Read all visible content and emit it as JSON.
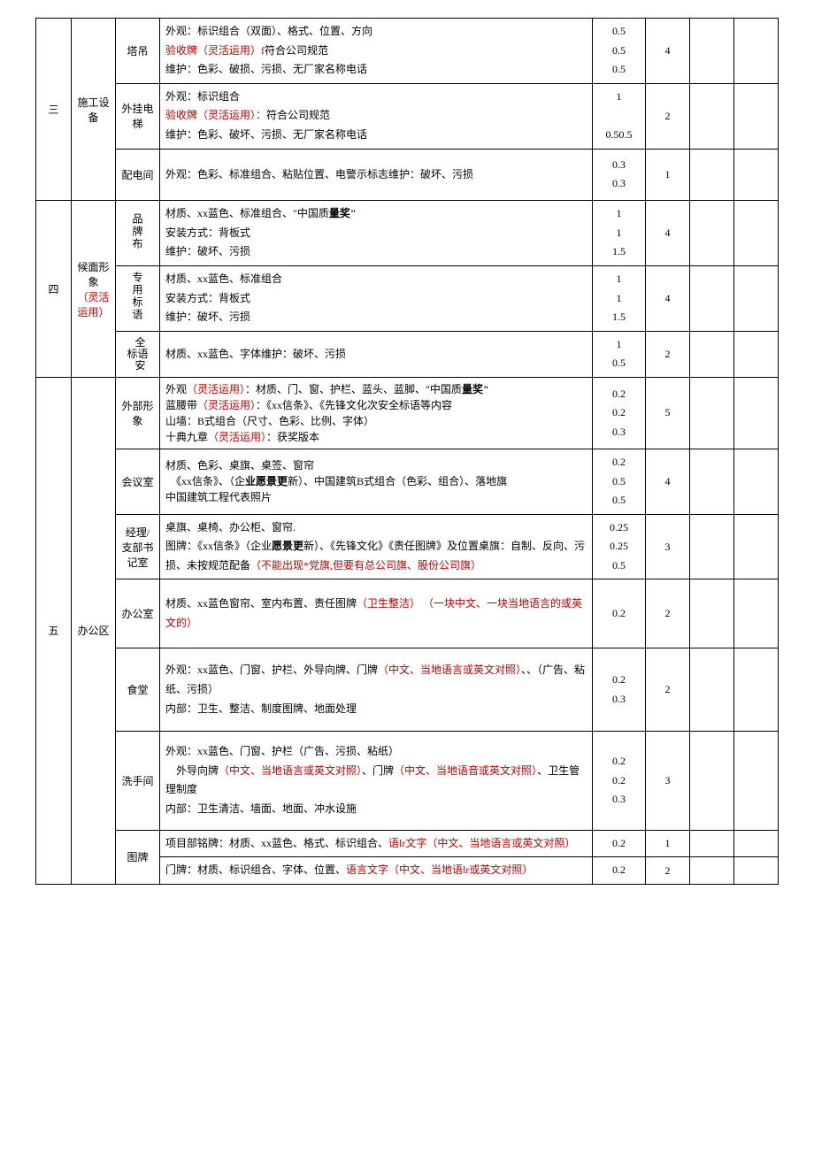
{
  "rows": {
    "r3": {
      "idx": "三",
      "cat": "施工设备",
      "sub1": "塔吊",
      "c1a": "外观：标识组合（双面）、格式、位置、方向",
      "c1b_red": "验收牌（灵活运用）f",
      "c1b_black": "符合公司规范",
      "c1c": "维护：色彩、破损、污损、无厂家名称电话",
      "s1a": "0.5",
      "s1b": "0.5",
      "s1c": "0.5",
      "t1": "4",
      "sub2": "外挂电梯",
      "c2a": "外观：标识组合",
      "c2b_red": "验收牌（灵活运用）：",
      "c2b_black": "符合公司规范",
      "c2c": "维护：色彩、破坏、污损、无厂家名称电话",
      "s2a": "1",
      "s2b": "0.50.5",
      "t2": "2",
      "sub3": "配电间",
      "c3": "外观：色彩、标准组合、粘贴位置、电警示标志维护：破坏、污损",
      "s3a": "0.3",
      "s3b": "0.3",
      "t3": "1"
    },
    "r4": {
      "idx": "四",
      "cat_l1": "候面形象",
      "cat_l2_red": "（灵活运用）",
      "sub1": "品牌布",
      "c1a_a": "材质、",
      "c1a_b": "xx",
      "c1a_c": "蓝色、标准组合、\"中国质",
      "c1a_d": "量奖\"",
      "c1b": "安装方式：背板式",
      "c1c": "维护：破坏、污损",
      "s1a": "1",
      "s1b": "1",
      "s1c": "1.5",
      "t1": "4",
      "sub2": "专用标语",
      "c2a_a": "材质、",
      "c2a_b": "xx",
      "c2a_c": "蓝色、标准组合",
      "c2b": "安装方式：背板式",
      "c2c": "维护：破坏、污损",
      "s2a": "1",
      "s2b": "1",
      "s2c": "1.5",
      "t2": "4",
      "sub3": "全标语安",
      "c3_a": "材质、",
      "c3_b": "xx",
      "c3_c": "蓝色、字体维护：破坏、污损",
      "s3a": "1",
      "s3b": "0.5",
      "t3": "2"
    },
    "r5": {
      "idx": "五",
      "cat": "办公区",
      "sub1": "外部形象",
      "c1_l1a": "外观",
      "c1_l1b_red": "（灵活运用）",
      "c1_l1c": "：材质、门、窗、护栏、蓝头、蓝脚、\"中国质",
      "c1_l1d": "量奖\"",
      "c1_l2a": "蓝腰带",
      "c1_l2b_red": "（灵活运用）",
      "c1_l2c": "：《",
      "c1_l2d": "xx",
      "c1_l2e": "信条》、《先锋文化次安全标语等内容",
      "c1_l3a": "山墙：",
      "c1_l3b": "B",
      "c1_l3c": "式组合（尺寸、色彩、比例、字体）",
      "c1_l4a": "十典九章",
      "c1_l4b_red": "（灵活运用）",
      "c1_l4c": "：获奖版本",
      "s1a": "0.2",
      "s1b": "0.2",
      "s1c": "0.3",
      "t1": "5",
      "sub2": "会议室",
      "c2_l1": "材质、色彩、桌旗、桌签、窗帘",
      "c2_l2a": "《",
      "c2_l2b": "xx",
      "c2_l2c": "信条》、（企",
      "c2_l2d": "业愿景更",
      "c2_l2e": "新）、中国建筑",
      "c2_l2f": "B",
      "c2_l2g": "式组合（色彩、组合）、落地旗",
      "c2_l3": "中国建筑工程代表照片",
      "s2a": "0.2",
      "s2b": "0.5",
      "s2c": "0.5",
      "t2": "4",
      "sub3": "经理/支部书记室",
      "c3_l1": "桌旗、桌椅、办公柜、窗帘.",
      "c3_l2a": "图牌：《",
      "c3_l2b": "xx",
      "c3_l2c": "信条》（企业",
      "c3_l2d": "愿景更",
      "c3_l2e": "新）、《先锋文化》《责任图牌》及位置桌旗：自制、反向、污损、未按规范配备",
      "c3_l2f_red": "（不能出现*党旗,但要有总公司旗、股份公司旗）",
      "s3a": "0.25",
      "s3b": "0.25",
      "s3c": "0.5",
      "t3": "3",
      "sub4": "办公室",
      "c4_a": "材质、",
      "c4_b": "xx",
      "c4_c": "蓝色窗帘、室内布置、责任图牌",
      "c4_d_red": "（卫生整洁）",
      "c4_e": "  ",
      "c4_f_red": "（一块中文、一块当地语言的或英文的）",
      "s4": "0.2",
      "t4": "2",
      "sub5": "食堂",
      "c5_l1a": "外观：",
      "c5_l1b": "xx",
      "c5_l1c": "蓝色、门窗、护栏、外导向牌、门牌",
      "c5_l1d_red": "（中文、当地语言或英文对照）",
      "c5_l1e": "、、（广告、粘纸、污损）",
      "c5_l2": "内部：卫生、整洁、制度图牌、地面处理",
      "s5a": "0.2",
      "s5b": "0.3",
      "t5": "2",
      "sub6": "洗手间",
      "c6_l1a": "外观：",
      "c6_l1b": "xx",
      "c6_l1c": "蓝色、门窗、护栏（广告、污损、粘纸）",
      "c6_l2a": "外导向牌",
      "c6_l2b_red": "（中文、当地语言或英文对照）",
      "c6_l2c": "、门牌",
      "c6_l2d_red": "（中文、当地语音或英文对照）",
      "c6_l2e": "、卫生管理制度",
      "c6_l3": "内部：卫生清洁、墙面、地面、冲水设施",
      "s6a": "0.2",
      "s6b": "0.2",
      "s6c": "0.3",
      "t6": "3",
      "sub7": "图牌",
      "c7a_l1a": "项目部铭牌：材质、",
      "c7a_l1b": "xx",
      "c7a_l1c": "蓝色、格式、标识组合、",
      "c7a_l1d_red": "语lr文字（中文、当地语言或英文对照）",
      "s7a": "0.2",
      "t7a": "1",
      "c7b_l1a": "门牌：材质、标识组合、字体、位置、",
      "c7b_l1b_red": "语言文字（中文、当地语lr或英文对照）",
      "s7b": "0.2",
      "t7b": "2"
    }
  }
}
